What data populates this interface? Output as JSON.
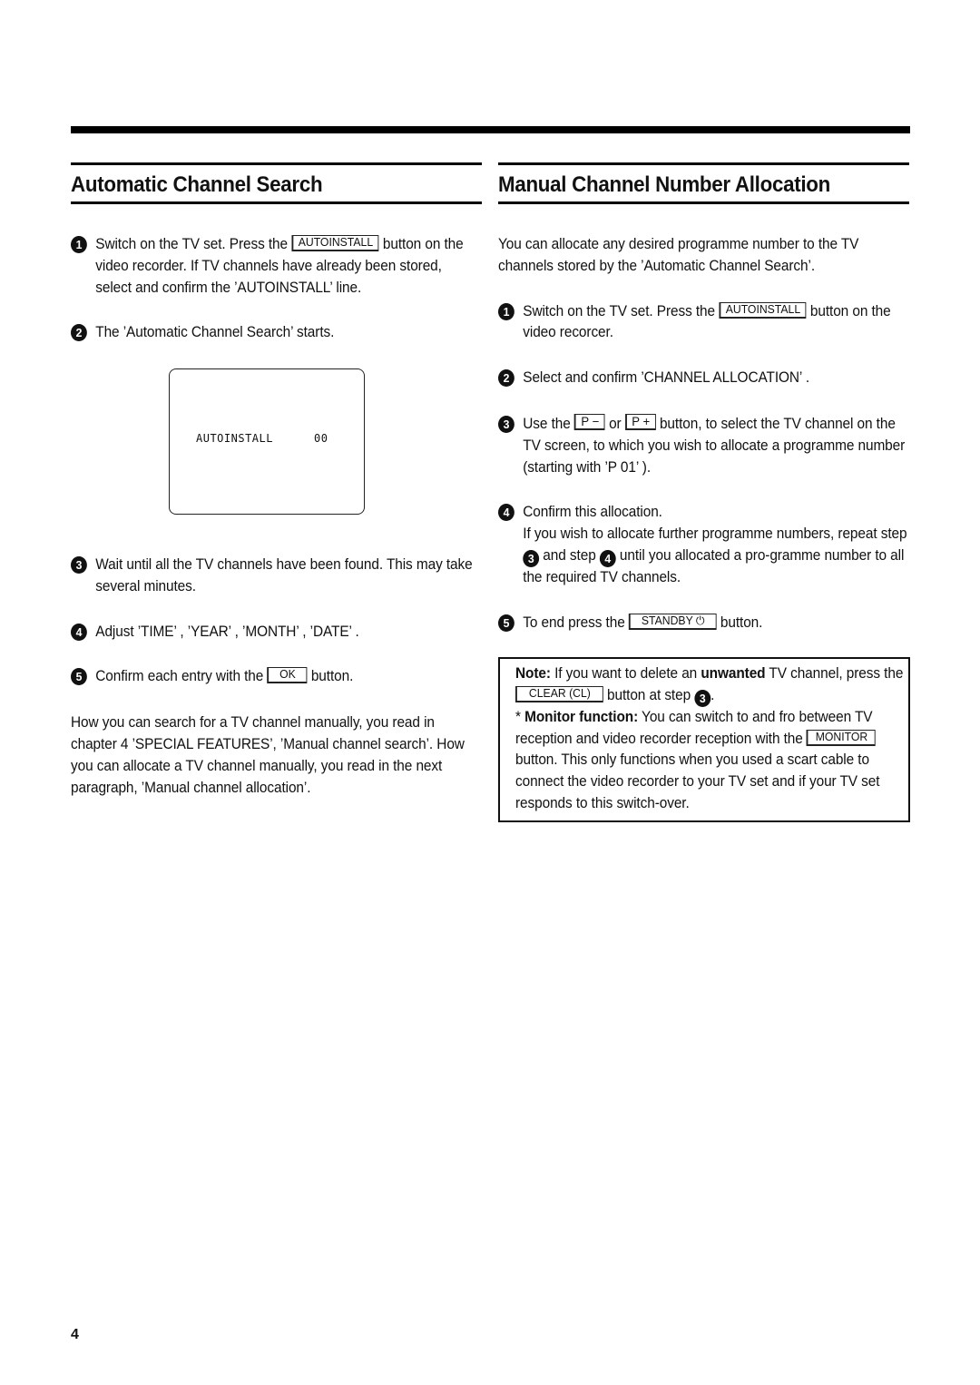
{
  "page_number": "4",
  "left": {
    "title": "Automatic Channel Search",
    "steps": [
      {
        "num": "1",
        "pre": "Switch on the TV set. Press the ",
        "key": "AUTOINSTALL",
        "post": " button on the video recorder. If TV channels have already been stored, select and confirm the ’AUTOINSTALL’ line."
      },
      {
        "num": "2",
        "text": "The ’Automatic Channel Search’ starts."
      },
      {
        "num": "3",
        "text": "Wait until all the TV channels have been found. This may take several minutes."
      },
      {
        "num": "4",
        "text": "Adjust ’TIME’ , ’YEAR’ , ’MONTH’ , ’DATE’ ."
      },
      {
        "num": "5",
        "pre": "Confirm each entry with the ",
        "key": "OK",
        "post": " button."
      }
    ],
    "tv_screen": {
      "label": "AUTOINSTALL",
      "value": "00"
    },
    "footer_paragraph": "How you can search for a TV channel manually, you read in chapter 4 ’SPECIAL FEATURES’, ’Manual channel search’. How you can allocate a TV channel manually, you read in the next paragraph, ’Manual channel allocation’."
  },
  "right": {
    "title": "Manual Channel Number Allocation",
    "intro": "You can allocate any desired programme number to the TV channels stored by the ’Automatic Channel Search’.",
    "steps": [
      {
        "num": "1",
        "pre": "Switch on the TV set. Press the ",
        "key": "AUTOINSTALL",
        "post": " button on the video recorcer."
      },
      {
        "num": "2",
        "text": "Select and confirm ’CHANNEL ALLOCATION’ ."
      },
      {
        "num": "3",
        "pre": "Use the ",
        "key1": "P −",
        "mid": " or ",
        "key2": "P +",
        "post": " button, to select the TV channel on the TV screen, to which you wish to allocate a programme number (starting with ’P 01’ )."
      },
      {
        "num": "4",
        "line1": "Confirm this allocation.",
        "line2_pre": "If you wish to allocate further programme numbers, repeat step ",
        "ref1": "3",
        "line2_mid": " and step ",
        "ref2": "4",
        "line2_post": " until you allocated a pro-gramme number to all the required TV channels."
      },
      {
        "num": "5",
        "pre": "To end press the ",
        "key": "STANDBY ⏻",
        "post": " button."
      }
    ],
    "note": {
      "label": "Note:",
      "text1": " If you want to delete an ",
      "bold": "unwanted",
      "text2": " TV channel, press the ",
      "key": "CLEAR (CL)",
      "text3": " button at step ",
      "ref": "3",
      "text4": ".",
      "monitor_star": "* ",
      "monitor_label": "Monitor function:",
      "monitor_text1": " You can switch to and fro between TV reception and video recorder reception with the ",
      "monitor_key": "MONITOR",
      "monitor_text2": " button. This only functions when you used a scart cable to connect the video recorder to your TV set and if your TV set responds to this switch-over."
    }
  }
}
